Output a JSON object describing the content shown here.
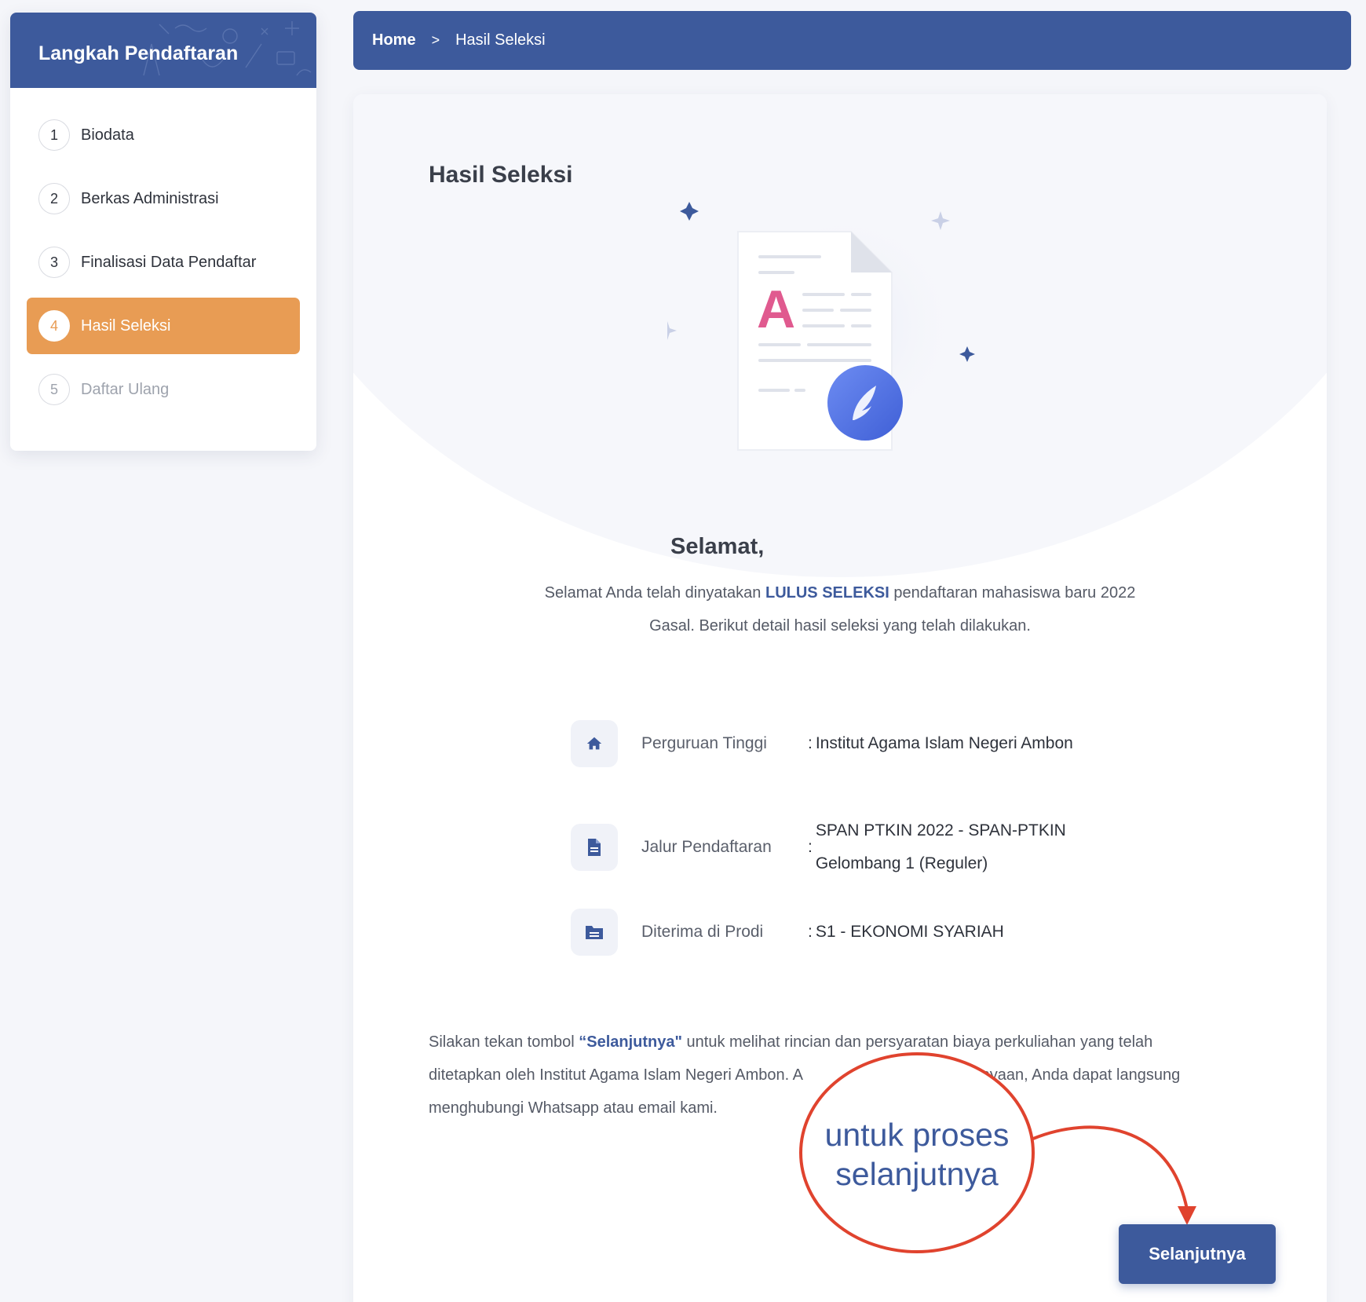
{
  "sidebar": {
    "title": "Langkah Pendaftaran",
    "steps": [
      {
        "num": "1",
        "label": "Biodata"
      },
      {
        "num": "2",
        "label": "Berkas Administrasi"
      },
      {
        "num": "3",
        "label": "Finalisasi Data Pendaftar"
      },
      {
        "num": "4",
        "label": "Hasil Seleksi"
      },
      {
        "num": "5",
        "label": "Daftar Ulang"
      }
    ]
  },
  "breadcrumb": {
    "home": "Home",
    "separator": ">",
    "current": "Hasil Seleksi"
  },
  "main": {
    "title": "Hasil Seleksi",
    "congrats": "Selamat,",
    "message": {
      "before": "Selamat Anda telah dinyatakan ",
      "highlight": "LULUS SELEKSI",
      "after": " pendaftaran mahasiswa baru 2022 Gasal. Berikut detail hasil seleksi yang telah dilakukan."
    },
    "details": [
      {
        "label": "Perguruan Tinggi",
        "value": "Institut Agama Islam Negeri Ambon",
        "icon": "home-icon"
      },
      {
        "label": "Jalur Pendaftaran",
        "value_line1": "SPAN PTKIN 2022 - SPAN-PTKIN",
        "value_line2": "Gelombang 1 (Reguler)",
        "icon": "document-icon"
      },
      {
        "label": "Diterima di Prodi",
        "value": "S1 - EKONOMI SYARIAH",
        "icon": "folder-icon"
      }
    ],
    "info": {
      "before": "Silakan tekan tombol ",
      "highlight": "“Selanjutnya\"",
      "after_line1": " untuk melihat rincian dan persyaratan biaya perkuliahan yang telah",
      "line2_start": "ditetapkan oleh Institut Agama Islam Negeri Ambon. A",
      "line2_end": "tanyaan, Anda dapat langsung",
      "line3": "menghubungi Whatsapp atau email kami."
    },
    "next_button": "Selanjutnya"
  },
  "annotation": {
    "line1": "untuk proses",
    "line2": "selanjutnya"
  },
  "colors": {
    "primary": "#3d5a9c",
    "active_step": "#e89c54",
    "annotation_red": "#e0432e"
  }
}
